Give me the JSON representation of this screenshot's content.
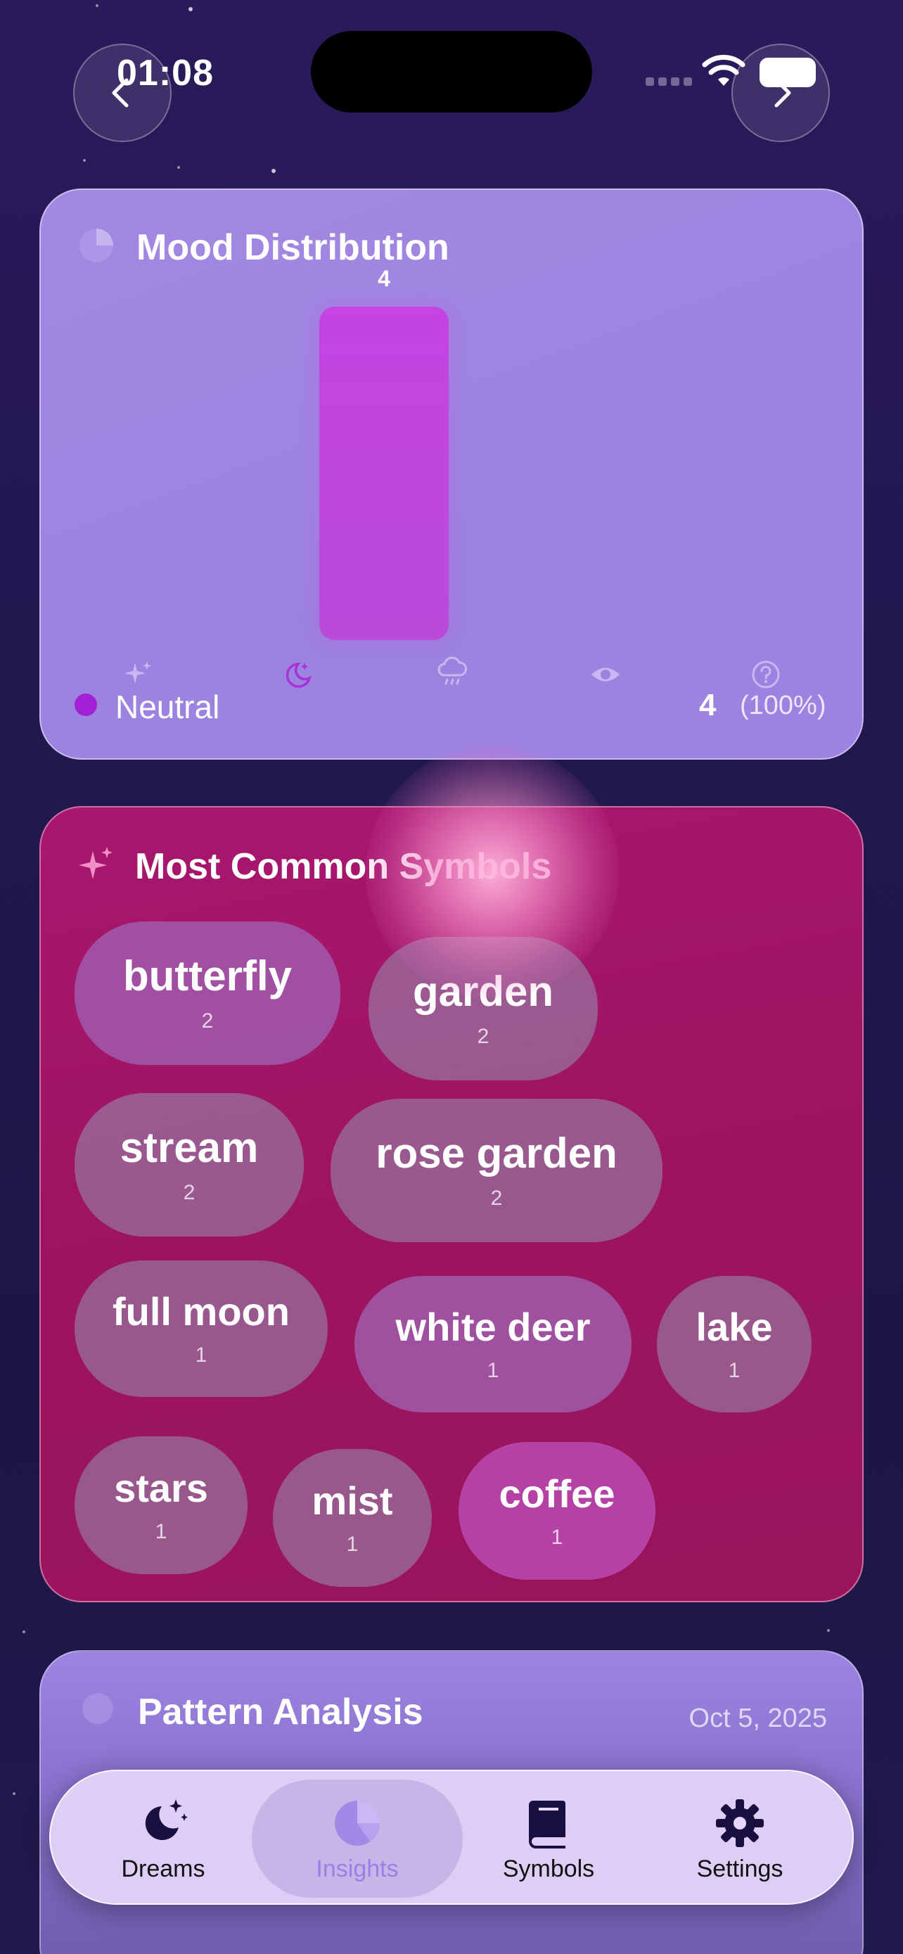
{
  "status_bar": {
    "time": "01:08"
  },
  "mood_card": {
    "title": "Mood Distribution",
    "legend": {
      "label": "Neutral",
      "count": "4",
      "percent": "(100%)"
    },
    "axis_icons": [
      "sparkles-icon",
      "moon-stars-icon",
      "cloud-rain-icon",
      "eye-icon",
      "question-icon"
    ]
  },
  "chart_data": {
    "type": "bar",
    "categories": [
      "sparkles",
      "moon",
      "cloud",
      "eye",
      "question"
    ],
    "values": [
      0,
      4,
      0,
      0,
      0
    ],
    "data_labels": [
      "",
      "4",
      "",
      "",
      ""
    ],
    "highlight_color": "#c544e2",
    "legend_placement": "bottom-left",
    "grid": false
  },
  "symbols_card": {
    "title": "Most Common Symbols",
    "symbols": [
      {
        "name": "butterfly",
        "count": "2"
      },
      {
        "name": "garden",
        "count": "2"
      },
      {
        "name": "stream",
        "count": "2"
      },
      {
        "name": "rose garden",
        "count": "2"
      },
      {
        "name": "full moon",
        "count": "1"
      },
      {
        "name": "white deer",
        "count": "1"
      },
      {
        "name": "lake",
        "count": "1"
      },
      {
        "name": "stars",
        "count": "1"
      },
      {
        "name": "mist",
        "count": "1"
      },
      {
        "name": "coffee",
        "count": "1"
      }
    ]
  },
  "pattern_card": {
    "title": "Pattern Analysis",
    "date": "Oct 5, 2025"
  },
  "tabs": [
    {
      "label": "Dreams",
      "icon": "moon-stars-icon"
    },
    {
      "label": "Insights",
      "icon": "pie-chart-icon",
      "active": true
    },
    {
      "label": "Symbols",
      "icon": "book-icon"
    },
    {
      "label": "Settings",
      "icon": "gear-icon"
    }
  ],
  "colors": {
    "mood_card_bg": "#a086e1",
    "symbols_card_bg": "#a0156a",
    "accent_active": "#9b7ee6"
  }
}
